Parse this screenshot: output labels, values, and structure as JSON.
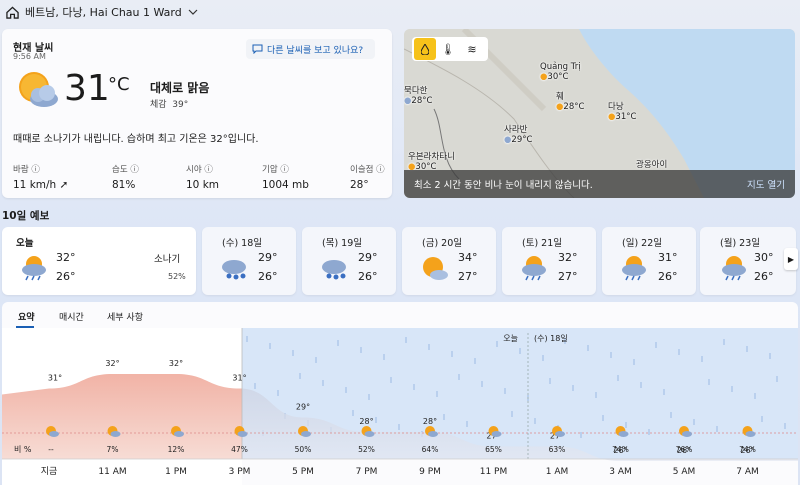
{
  "header": {
    "location": "베트남, 다낭, Hai Chau 1 Ward"
  },
  "current": {
    "title": "현재 날씨",
    "time": "9:56 AM",
    "temp": "31",
    "unit": "°C",
    "condition": "대체로 맑음",
    "feels_label": "체감",
    "feels_value": "39°",
    "summary": "때때로 소나기가 내립니다. 습하며 최고 기온은 32°입니다.",
    "feedback": "다른 날씨를 보고 있나요?",
    "metrics": [
      {
        "k": "바람",
        "v": "11 km/h"
      },
      {
        "k": "습도",
        "v": "81%"
      },
      {
        "k": "시야",
        "v": "10 km"
      },
      {
        "k": "기압",
        "v": "1004 mb"
      },
      {
        "k": "이슬점",
        "v": "28°"
      }
    ]
  },
  "map": {
    "cities": [
      {
        "n": "Quảng Trị",
        "t": "30°C"
      },
      {
        "n": "묵다한",
        "t": "28°C"
      },
      {
        "n": "훼",
        "t": "28°C"
      },
      {
        "n": "다낭",
        "t": "31°C"
      },
      {
        "n": "사라반",
        "t": "29°C"
      },
      {
        "n": "우본라차타니",
        "t": "30°C"
      },
      {
        "n": "광옹아이",
        "t": ""
      }
    ],
    "banner": "최소 2 시간 동안 비나 눈이 내리지 않습니다.",
    "open": "지도 열기"
  },
  "forecast": {
    "title": "10일 예보",
    "days": [
      {
        "name": "오늘",
        "hi": "32°",
        "lo": "26°",
        "cond": "소나기",
        "rain": "52%"
      },
      {
        "name": "(수) 18일",
        "hi": "29°",
        "lo": "26°"
      },
      {
        "name": "(목) 19일",
        "hi": "29°",
        "lo": "26°"
      },
      {
        "name": "(금) 20일",
        "hi": "34°",
        "lo": "27°"
      },
      {
        "name": "(토) 21일",
        "hi": "32°",
        "lo": "27°"
      },
      {
        "name": "(일) 22일",
        "hi": "31°",
        "lo": "26°"
      },
      {
        "name": "(월) 23일",
        "hi": "30°",
        "lo": "26°"
      }
    ]
  },
  "tabs": [
    "요약",
    "매시간",
    "세부 사항"
  ],
  "chart_data": {
    "type": "area",
    "x": [
      "지금",
      "11 AM",
      "1 PM",
      "3 PM",
      "5 PM",
      "7 PM",
      "9 PM",
      "11 PM",
      "1 AM",
      "3 AM",
      "5 AM",
      "7 AM"
    ],
    "temps": [
      31,
      32,
      32,
      31,
      29,
      28,
      28,
      27,
      27,
      26,
      26,
      26
    ],
    "rain_label": "비 %",
    "rain": [
      "--",
      "7%",
      "12%",
      "47%",
      "50%",
      "52%",
      "64%",
      "65%",
      "63%",
      "74%",
      "76%",
      "74%"
    ],
    "day_labels": [
      "오늘",
      "(수) 18일"
    ]
  }
}
